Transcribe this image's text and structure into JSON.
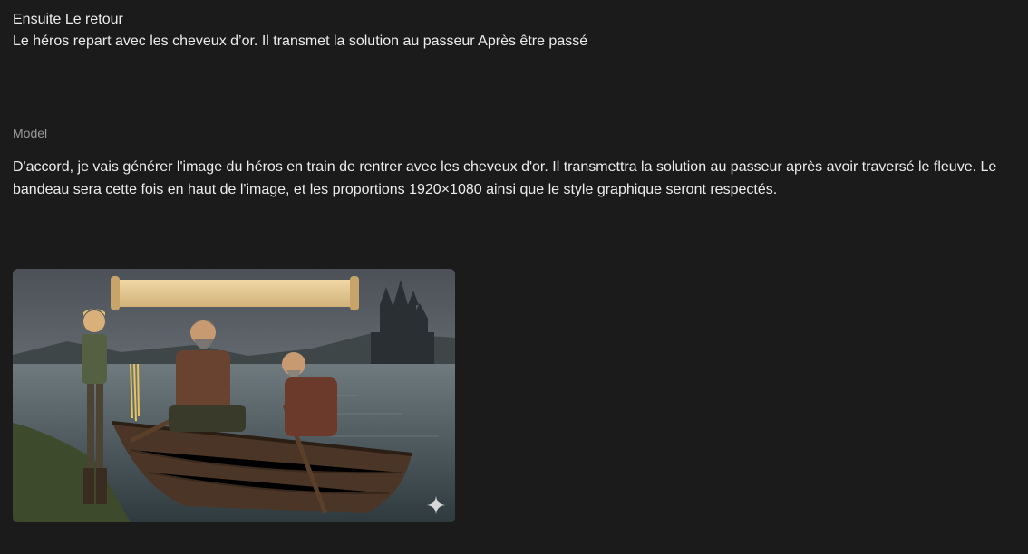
{
  "user_message": {
    "line1": "Ensuite Le retour",
    "line2": "Le héros repart avec les cheveux d’or. Il transmet la solution au passeur Après être passé"
  },
  "model": {
    "label": "Model",
    "text": "D'accord, je vais générer l'image du héros en train de rentrer avec les cheveux d'or. Il transmettra la solution au passeur après avoir traversé le fleuve. Le bandeau sera cette fois en haut de l'image, et les proportions 1920×1080 ainsi que le style graphique seront respectés.",
    "image": {
      "icon": "sparkle-icon"
    }
  }
}
